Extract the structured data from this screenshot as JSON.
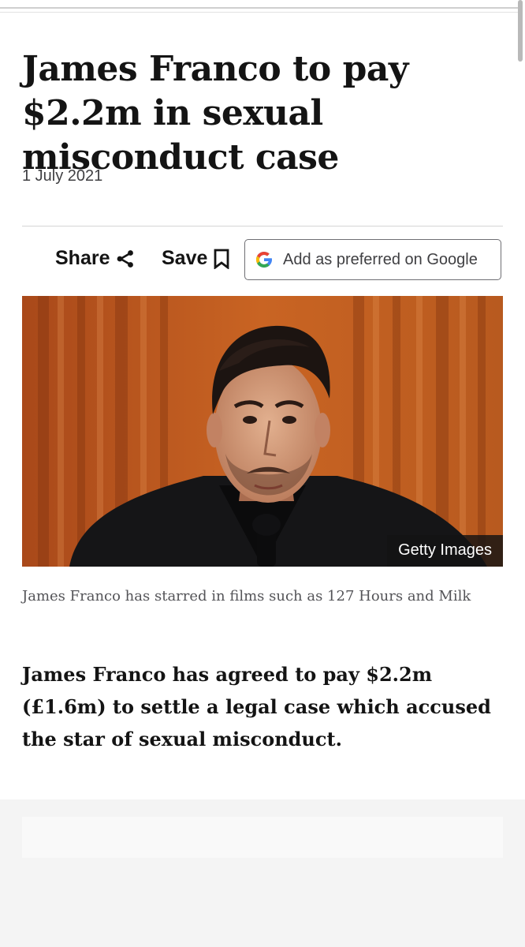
{
  "article": {
    "title": "James Franco to pay $2.2m in sexual misconduct case",
    "date": "1 July 2021"
  },
  "actions": {
    "share_label": "Share",
    "save_label": "Save",
    "google_label": "Add as preferred on Google"
  },
  "image": {
    "credit": "Getty Images",
    "caption": "James Franco has starred in films such as 127 Hours and Milk"
  },
  "body": {
    "lead": "James Franco has agreed to pay $2.2m (£1.6m) to settle a legal case which accused the star of sexual misconduct."
  },
  "icons": {
    "share": "share-icon",
    "save": "bookmark-icon",
    "google": "google-g-icon"
  },
  "colors": {
    "text": "#141414",
    "muted": "#3f3f42",
    "curtain": "#b8571c",
    "google_blue": "#4285F4",
    "google_red": "#EA4335",
    "google_yellow": "#FBBC05",
    "google_green": "#34A853"
  }
}
